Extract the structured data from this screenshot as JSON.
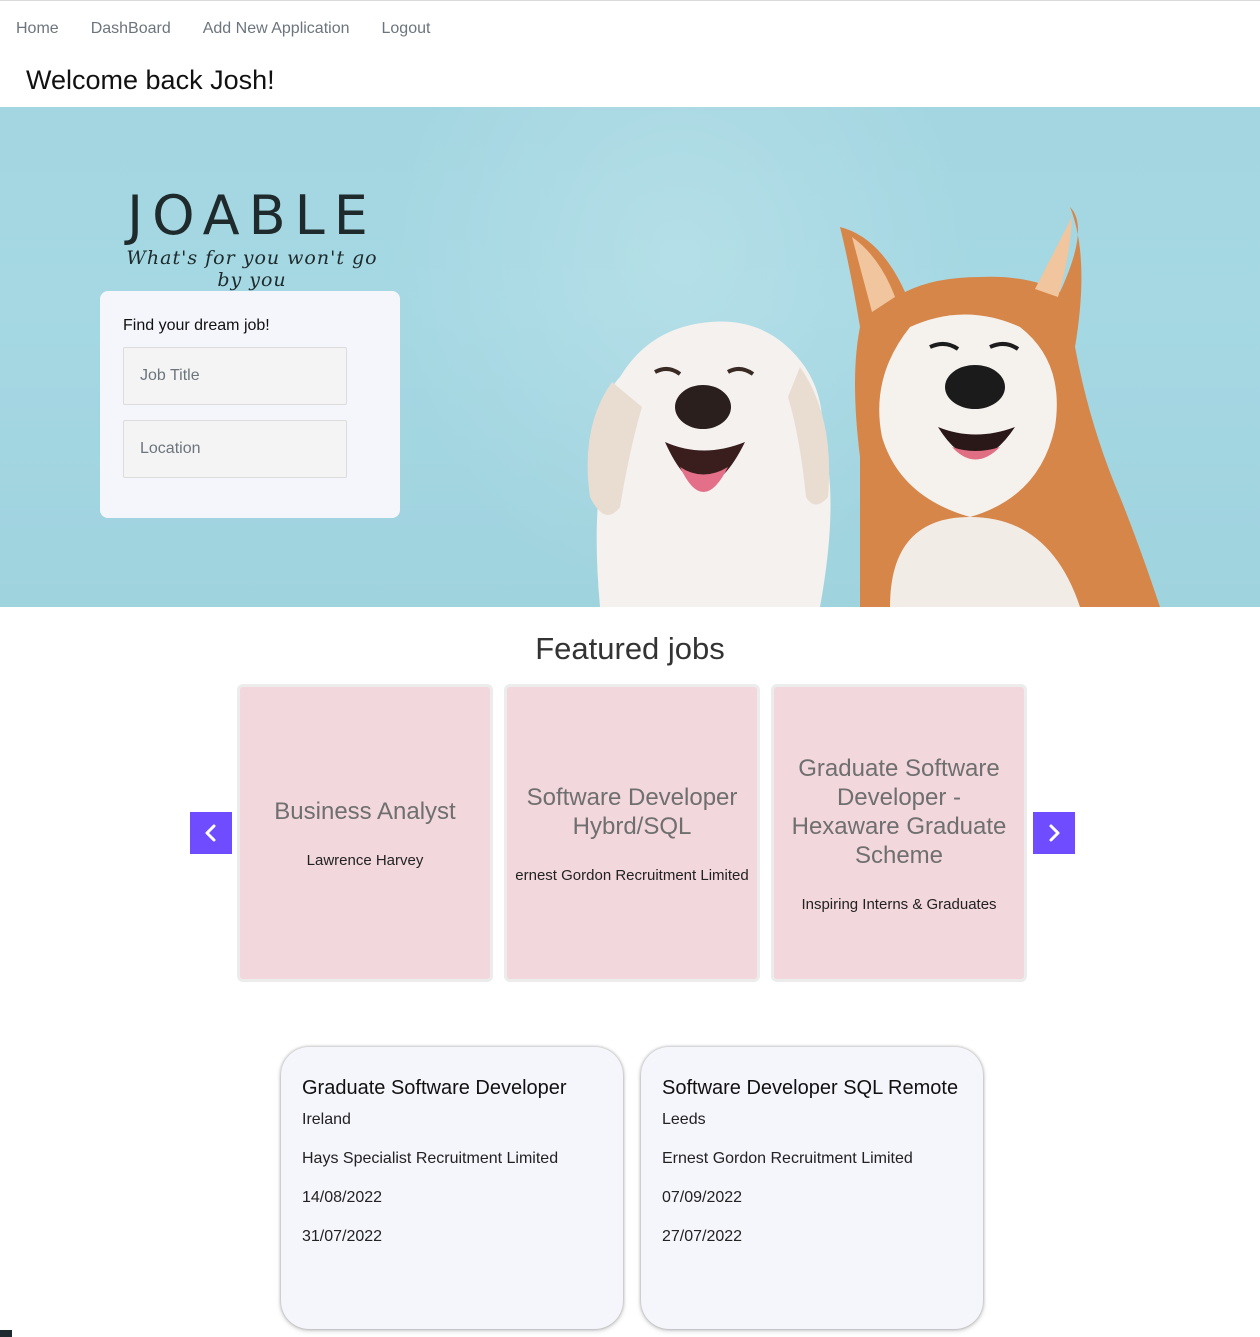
{
  "nav": {
    "items": [
      {
        "label": "Home"
      },
      {
        "label": "DashBoard"
      },
      {
        "label": "Add New Application"
      },
      {
        "label": "Logout"
      }
    ]
  },
  "welcome": "Welcome back Josh!",
  "hero": {
    "brand_name": "JOABLE",
    "brand_tagline": "What's for you won't go by you",
    "search": {
      "title": "Find your dream job!",
      "job_title_placeholder": "Job Title",
      "location_placeholder": "Location"
    }
  },
  "featured": {
    "title": "Featured jobs",
    "cards": [
      {
        "title": "Business Analyst",
        "company": "Lawrence Harvey"
      },
      {
        "title": "Software Developer Hybrd/SQL",
        "company": "ernest Gordon Recruitment Limited"
      },
      {
        "title": "Graduate Software Developer - Hexaware Graduate Scheme",
        "company": "Inspiring Interns & Graduates"
      }
    ],
    "prev_icon": "chevron-left-icon",
    "next_icon": "chevron-right-icon",
    "accent_color": "#6f4cff",
    "card_color": "#f2d7dc"
  },
  "jobs": [
    {
      "title": "Graduate Software Developer",
      "location": "Ireland",
      "company": "Hays Specialist Recruitment Limited",
      "date1": "14/08/2022",
      "date2": "31/07/2022"
    },
    {
      "title": "Software Developer SQL Remote",
      "location": "Leeds",
      "company": "Ernest Gordon Recruitment Limited",
      "date1": "07/09/2022",
      "date2": "27/07/2022"
    }
  ]
}
